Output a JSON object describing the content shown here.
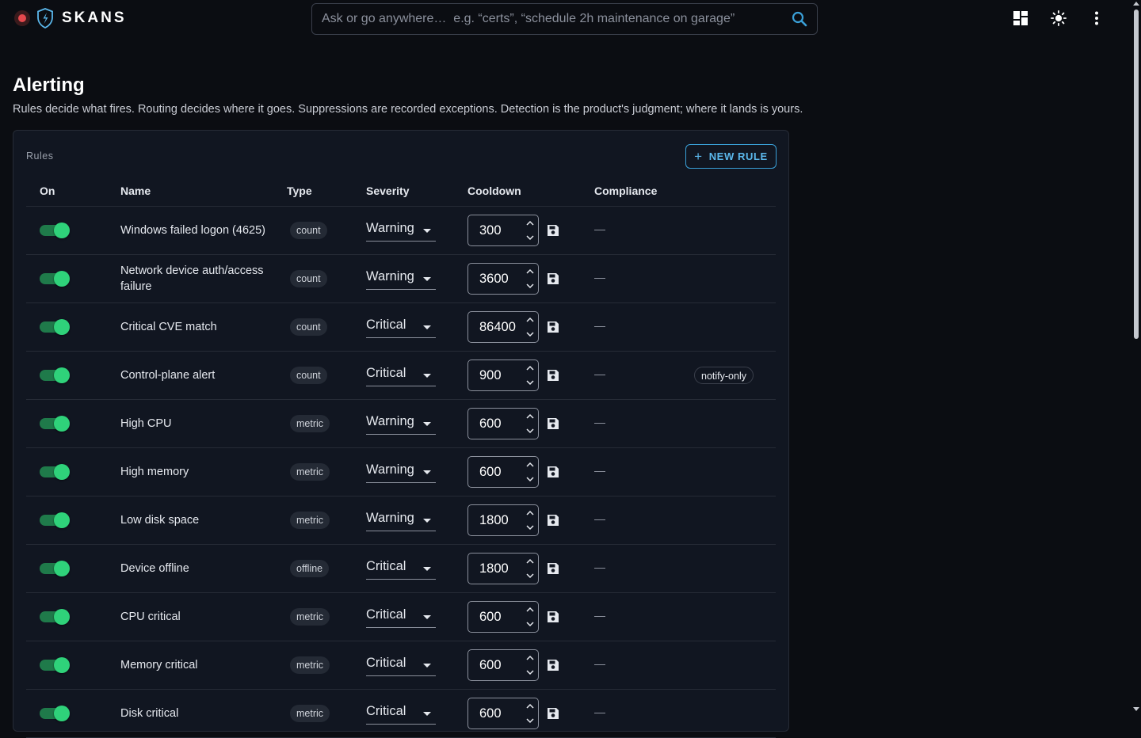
{
  "app": {
    "name": "SKANS"
  },
  "search": {
    "placeholder": "Ask or go anywhere…  e.g. “certs”, “schedule 2h maintenance on garage”"
  },
  "page": {
    "title": "Alerting",
    "subtitle": "Rules decide what fires. Routing decides where it goes. Suppressions are recorded exceptions. Detection is the product's judgment; where it lands is yours."
  },
  "rules_card": {
    "label": "Rules",
    "new_rule_label": "NEW RULE",
    "columns": {
      "on": "On",
      "name": "Name",
      "type": "Type",
      "severity": "Severity",
      "cooldown": "Cooldown",
      "compliance": "Compliance"
    },
    "rows": [
      {
        "on": true,
        "name": "Windows failed logon (4625)",
        "type": "count",
        "severity": "Warning",
        "cooldown": "300",
        "compliance": "—",
        "tag": ""
      },
      {
        "on": true,
        "name": "Network device auth/access failure",
        "type": "count",
        "severity": "Warning",
        "cooldown": "3600",
        "compliance": "—",
        "tag": ""
      },
      {
        "on": true,
        "name": "Critical CVE match",
        "type": "count",
        "severity": "Critical",
        "cooldown": "86400",
        "compliance": "—",
        "tag": ""
      },
      {
        "on": true,
        "name": "Control-plane alert",
        "type": "count",
        "severity": "Critical",
        "cooldown": "900",
        "compliance": "—",
        "tag": "notify-only"
      },
      {
        "on": true,
        "name": "High CPU",
        "type": "metric",
        "severity": "Warning",
        "cooldown": "600",
        "compliance": "—",
        "tag": ""
      },
      {
        "on": true,
        "name": "High memory",
        "type": "metric",
        "severity": "Warning",
        "cooldown": "600",
        "compliance": "—",
        "tag": ""
      },
      {
        "on": true,
        "name": "Low disk space",
        "type": "metric",
        "severity": "Warning",
        "cooldown": "1800",
        "compliance": "—",
        "tag": ""
      },
      {
        "on": true,
        "name": "Device offline",
        "type": "offline",
        "severity": "Critical",
        "cooldown": "1800",
        "compliance": "—",
        "tag": ""
      },
      {
        "on": true,
        "name": "CPU critical",
        "type": "metric",
        "severity": "Critical",
        "cooldown": "600",
        "compliance": "—",
        "tag": ""
      },
      {
        "on": true,
        "name": "Memory critical",
        "type": "metric",
        "severity": "Critical",
        "cooldown": "600",
        "compliance": "—",
        "tag": ""
      },
      {
        "on": true,
        "name": "Disk critical",
        "type": "metric",
        "severity": "Critical",
        "cooldown": "600",
        "compliance": "—",
        "tag": ""
      }
    ]
  },
  "icons": {
    "record": "record-icon",
    "shield": "shield-icon",
    "search": "search-icon",
    "dashboard": "dashboard-icon",
    "theme": "sun-icon",
    "menu": "more-vertical-icon",
    "save": "save-icon",
    "spin": "spinner-arrows-icon"
  },
  "colors": {
    "accent": "#3aa0d8",
    "toggle_on": "#2fd27a",
    "record": "#e5484d",
    "background": "#0b0d12",
    "card": "#111621"
  }
}
